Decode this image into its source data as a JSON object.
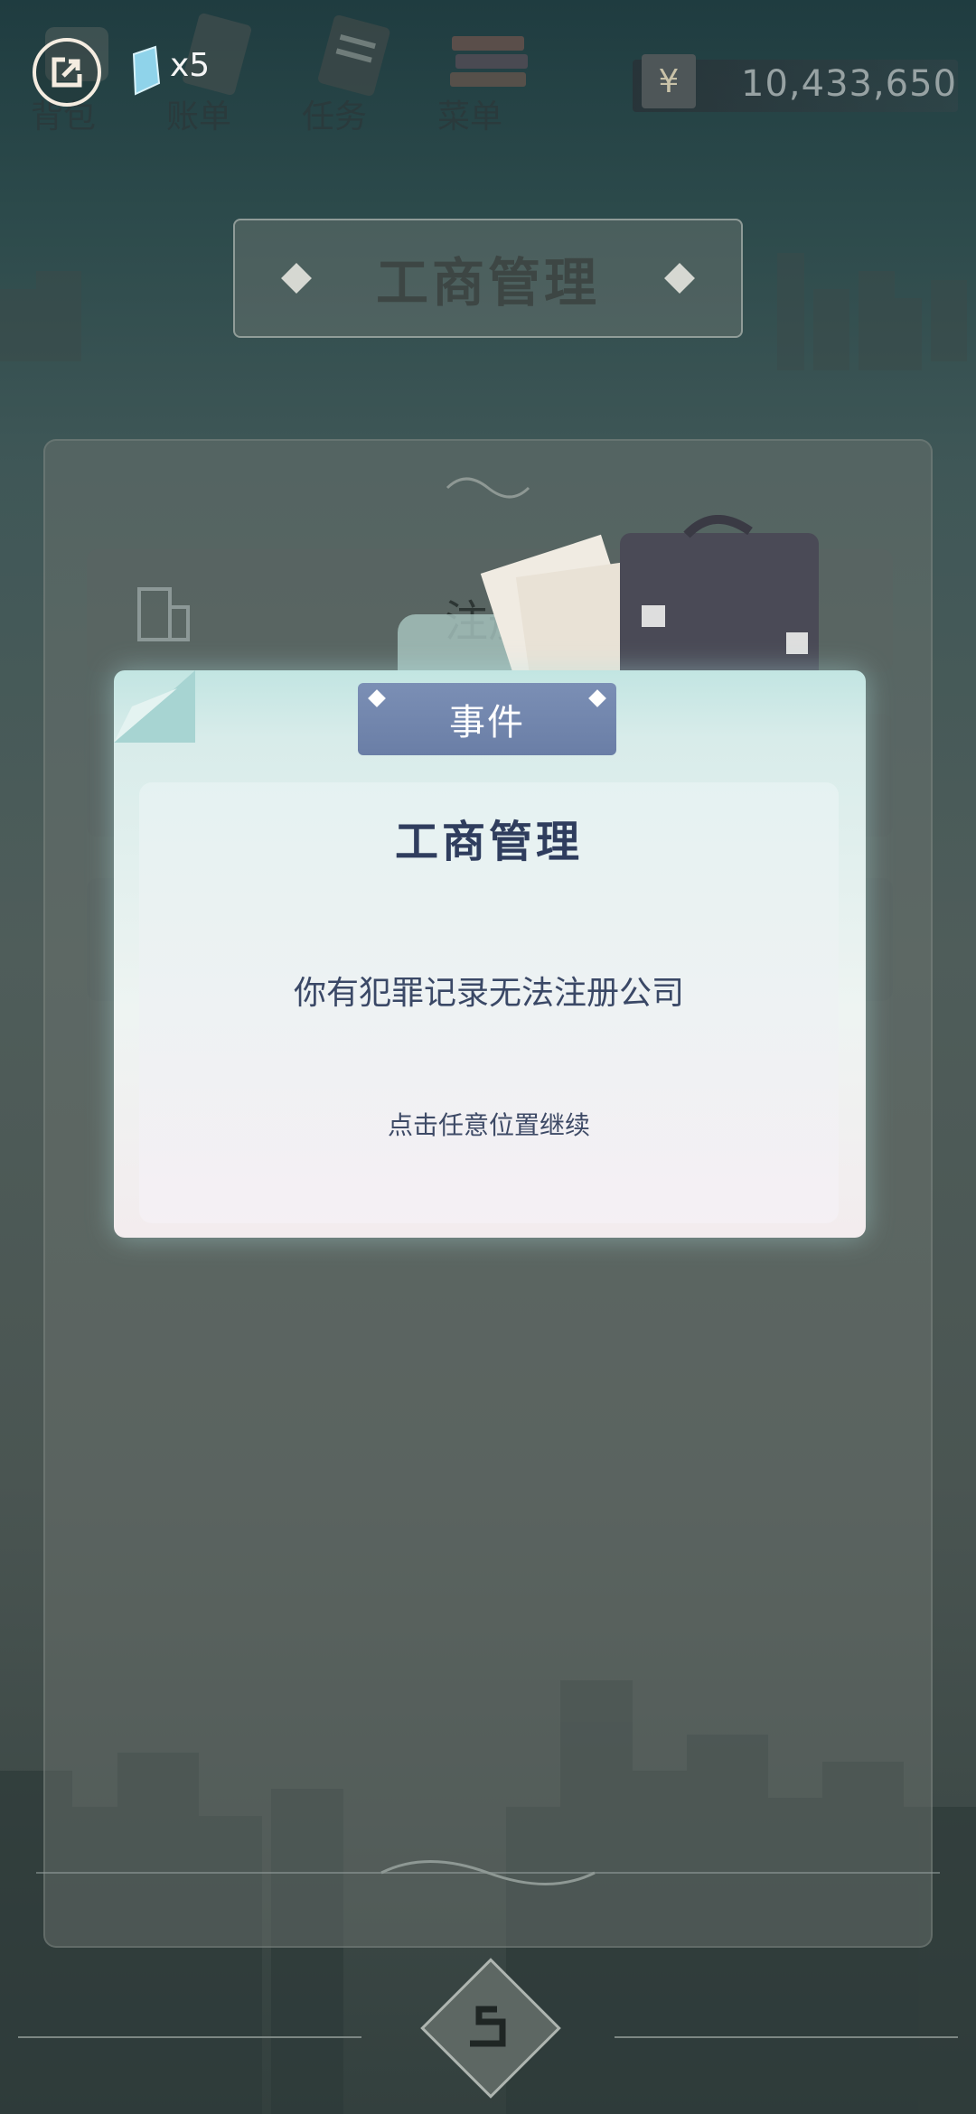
{
  "topbar": {
    "items": [
      {
        "label": "背包",
        "icon": "bag-icon"
      },
      {
        "label": "账单",
        "icon": "bill-icon"
      },
      {
        "label": "任务",
        "icon": "task-icon"
      },
      {
        "label": "菜单",
        "icon": "menu-books-icon"
      }
    ],
    "share_icon": "share-exit-icon",
    "diamond_count": "x5",
    "currency_symbol": "¥",
    "money": "10,433,650"
  },
  "page": {
    "title": "工商管理"
  },
  "panel": {
    "rows": [
      {
        "label": "注册"
      }
    ]
  },
  "modal": {
    "tab_label": "事件",
    "title": "工商管理",
    "message": "你有犯罪记录无法注册公司",
    "hint": "点击任意位置继续"
  },
  "colors": {
    "modal_title": "#2f3d5e",
    "tab_bg": "#7b8fb5",
    "money_text": "#97a2a3"
  }
}
